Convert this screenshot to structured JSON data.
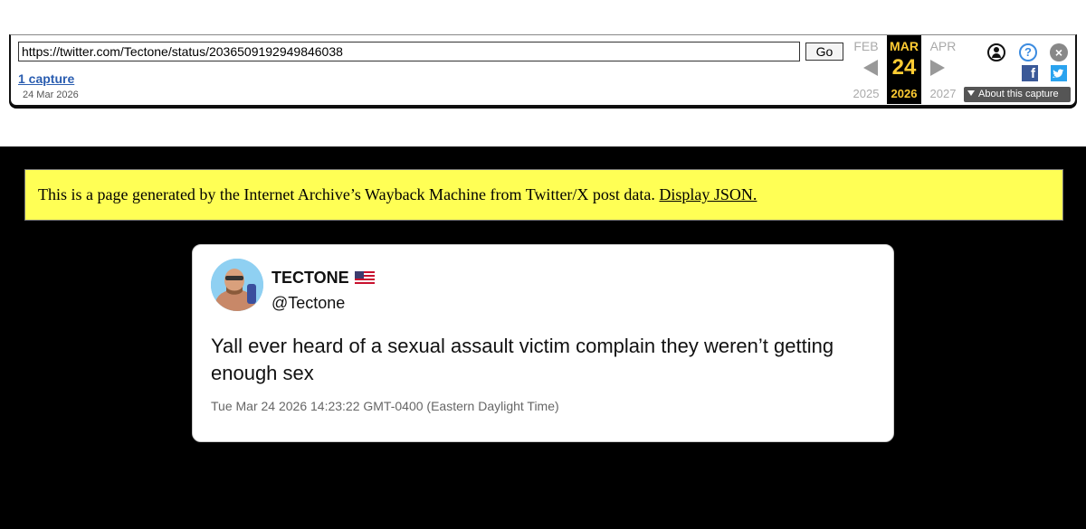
{
  "wayback": {
    "url_value": "https://twitter.com/Tectone/status/2036509192949846038",
    "go_label": "Go",
    "captures_link": "1 capture",
    "captures_date": "24 Mar 2026",
    "prev_month": "FEB",
    "current_month": "MAR",
    "next_month": "APR",
    "current_day": "24",
    "prev_year": "2025",
    "current_year": "2026",
    "next_year": "2027",
    "help_glyph": "?",
    "close_glyph": "×",
    "facebook_glyph": "f",
    "about_label": "About this capture",
    "icons": [
      "user-icon",
      "help-icon",
      "close-icon",
      "facebook-icon",
      "twitter-icon"
    ]
  },
  "notice": {
    "text": "This is a page generated by the Internet Archive’s Wayback Machine from Twitter/X post data.",
    "link": "Display JSON."
  },
  "tweet": {
    "display_name": "TECTONE",
    "flag_icon": "us-flag-icon",
    "handle": "@Tectone",
    "text": "Yall ever heard of a sexual assault victim complain they weren’t getting enough sex",
    "timestamp": "Tue Mar 24 2026 14:23:22 GMT-0400 (Eastern Daylight Time)"
  },
  "colors": {
    "page_bg": "#000000",
    "notice_bg": "#ffff55",
    "calendar_highlight": "#ffcc33",
    "link": "#2a5db0"
  }
}
